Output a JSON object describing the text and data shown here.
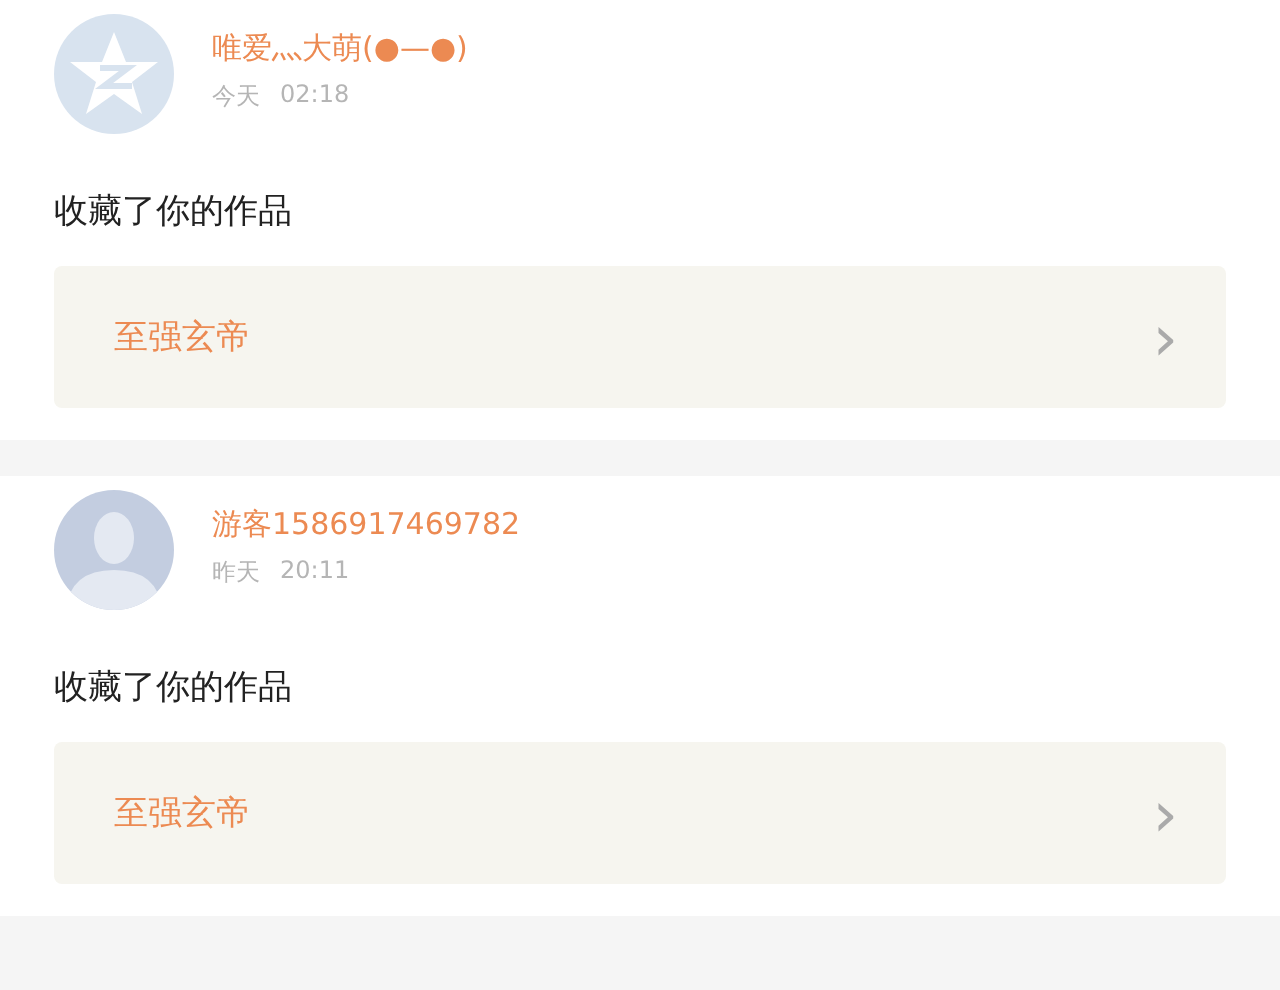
{
  "notifications": [
    {
      "kind": "star",
      "user": "唯爱灬大萌(●—●)",
      "date": "今天",
      "time": "02:18",
      "action": "收藏了你的作品",
      "work": "至强玄帝",
      "chevron": "›"
    },
    {
      "kind": "person",
      "user": "游客1586917469782",
      "date": "昨天",
      "time": "20:11",
      "action": "收藏了你的作品",
      "work": "至强玄帝",
      "chevron": "›"
    }
  ]
}
